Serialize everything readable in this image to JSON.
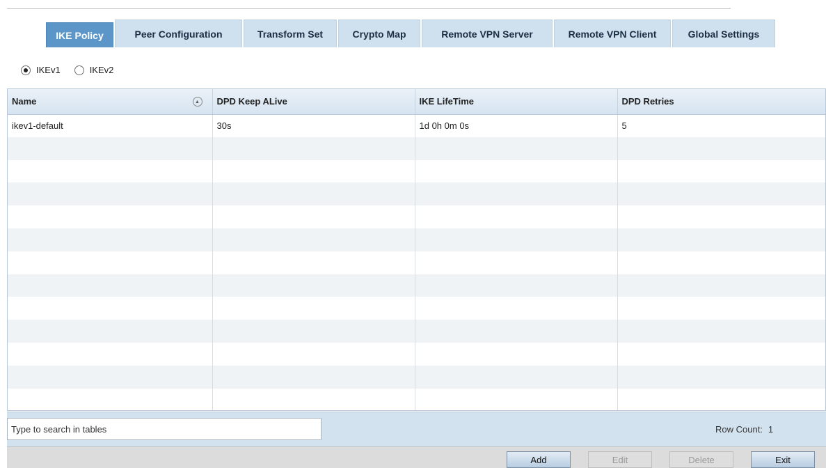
{
  "tabs": [
    {
      "label": "IKE Policy",
      "active": true
    },
    {
      "label": "Peer Configuration",
      "active": false
    },
    {
      "label": "Transform Set",
      "active": false
    },
    {
      "label": "Crypto Map",
      "active": false
    },
    {
      "label": "Remote VPN Server",
      "active": false
    },
    {
      "label": "Remote VPN Client",
      "active": false
    },
    {
      "label": "Global Settings",
      "active": false
    }
  ],
  "version_radios": [
    {
      "label": "IKEv1",
      "checked": true
    },
    {
      "label": "IKEv2",
      "checked": false
    }
  ],
  "table": {
    "columns": [
      "Name",
      "DPD Keep ALive",
      "IKE LifeTime",
      "DPD Retries"
    ],
    "rows": [
      [
        "ikev1-default",
        "30s",
        "1d 0h 0m 0s",
        "5"
      ]
    ]
  },
  "search": {
    "placeholder": "Type to search in tables",
    "value": ""
  },
  "row_count": {
    "label": "Row Count:",
    "value": "1"
  },
  "buttons": {
    "add": "Add",
    "edit": "Edit",
    "delete": "Delete",
    "exit": "Exit"
  }
}
